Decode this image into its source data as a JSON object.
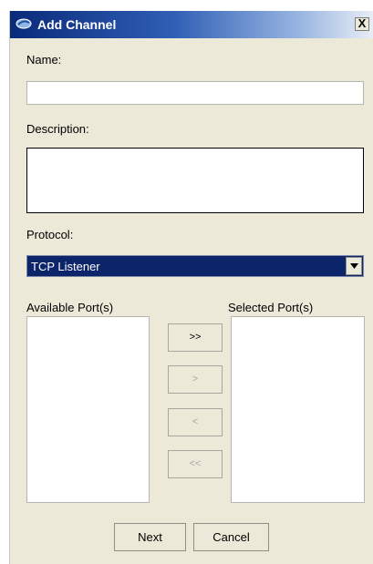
{
  "window": {
    "title": "Add Channel",
    "close_label": "X"
  },
  "form": {
    "name_label": "Name:",
    "name_value": "",
    "description_label": "Description:",
    "description_value": "",
    "protocol_label": "Protocol:",
    "protocol_value": "TCP Listener"
  },
  "ports": {
    "available_label": "Available Port(s)",
    "selected_label": "Selected Port(s)",
    "add_all_label": ">>",
    "add_label": ">",
    "remove_label": "<",
    "remove_all_label": "<<"
  },
  "footer": {
    "next_label": "Next",
    "cancel_label": "Cancel"
  },
  "colors": {
    "titlebar_start": "#0a2a7a",
    "selection_bg": "#0c246a",
    "dialog_bg": "#ece9d8"
  }
}
